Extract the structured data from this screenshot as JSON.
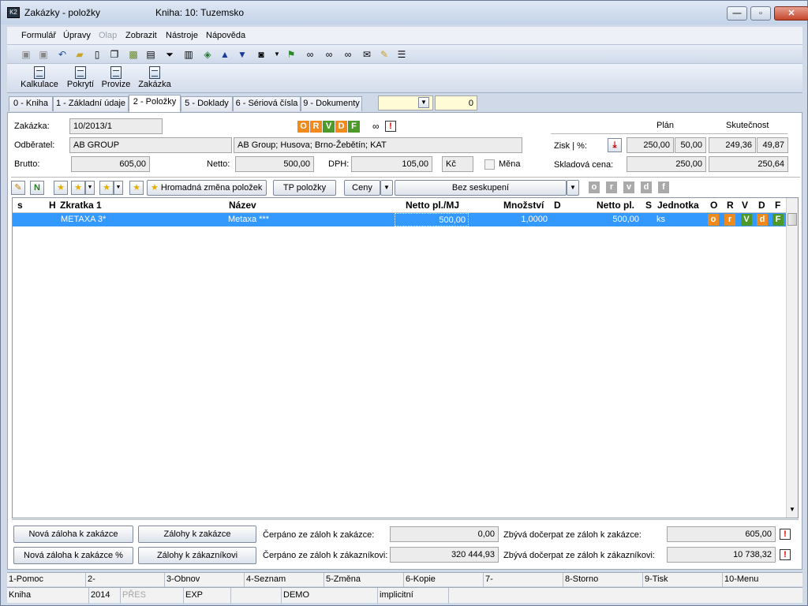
{
  "window": {
    "title": "Zakázky - položky",
    "subtitle": "Kniha: 10: Tuzemsko",
    "minimize": "—",
    "maximize": "▫",
    "close": "✕"
  },
  "menu": [
    {
      "label": "Formulář",
      "disabled": false
    },
    {
      "label": "Úpravy",
      "disabled": false
    },
    {
      "label": "Olap",
      "disabled": true
    },
    {
      "label": "Zobrazit",
      "disabled": false
    },
    {
      "label": "Nástroje",
      "disabled": false
    },
    {
      "label": "Nápověda",
      "disabled": false
    }
  ],
  "toolbar2": [
    {
      "label": "Kalkulace"
    },
    {
      "label": "Pokrytí"
    },
    {
      "label": "Provize"
    },
    {
      "label": "Zakázka"
    }
  ],
  "tabs": [
    {
      "label": "0 - Kniha"
    },
    {
      "label": "1 - Základní údaje"
    },
    {
      "label": "2 - Položky"
    },
    {
      "label": "5 - Doklady"
    },
    {
      "label": "6 - Sériová čísla"
    },
    {
      "label": "9 - Dokumenty"
    }
  ],
  "tab_extra_value": "0",
  "form": {
    "zakazka_label": "Zakázka:",
    "zakazka_value": "10/2013/1",
    "odberatel_label": "Odběratel:",
    "odberatel_value": "AB GROUP",
    "odberatel_address": "AB Group; Husova; Brno-Žebětín; KAT",
    "brutto_label": "Brutto:",
    "brutto_value": "605,00",
    "netto_label": "Netto:",
    "netto_value": "500,00",
    "dph_label": "DPH:",
    "dph_value": "105,00",
    "currency_value": "Kč",
    "mena_label": "Měna",
    "status_letters": [
      "O",
      "R",
      "V",
      "D",
      "F"
    ],
    "plan_header": "Plán",
    "skutecnost_header": "Skutečnost",
    "zisk_label": "Zisk | %:",
    "zisk_plan": "250,00",
    "zisk_plan_pct": "50,00",
    "zisk_skut": "249,36",
    "zisk_skut_pct": "49,87",
    "sklad_label": "Skladová cena:",
    "sklad_plan": "250,00",
    "sklad_skut": "250,64"
  },
  "gridtoolbar": {
    "hromadna": "Hromadná změna položek",
    "tp": "TP položky",
    "ceny": "Ceny",
    "seskupeni": "Bez seskupení",
    "letters": [
      "o",
      "r",
      "v",
      "d",
      "f"
    ]
  },
  "grid": {
    "headers": {
      "s": "s",
      "h": "H",
      "zkratka": "Zkratka 1",
      "nazev": "Název",
      "netto_mj": "Netto pl./MJ",
      "mnozstvi": "Množství",
      "d": "D",
      "netto": "Netto pl.",
      "s2": "S",
      "jednotka": "Jednotka",
      "o": "O",
      "r": "R",
      "v": "V",
      "d2": "D",
      "f": "F"
    },
    "rows": [
      {
        "zkratka": "METAXA 3*",
        "nazev": "Metaxa ***",
        "netto_mj": "500,00",
        "mnozstvi": "1,0000",
        "netto": "500,00",
        "jednotka": "ks",
        "o": "o",
        "r": "r",
        "v": "V",
        "d": "d",
        "f": "F"
      }
    ]
  },
  "bottom": {
    "btn1": "Nová záloha k zakázce",
    "btn2": "Zálohy k zakázce",
    "btn3": "Nová záloha k zakázce %",
    "btn4": "Zálohy k zákazníkovi",
    "cerp_zak_label": "Čerpáno ze záloh k zakázce:",
    "cerp_zak_value": "0,00",
    "cerp_zaka_label": "Čerpáno ze záloh k zákazníkovi:",
    "cerp_zaka_value": "320 444,93",
    "zbyva_zak_label": "Zbývá dočerpat ze záloh k zakázce:",
    "zbyva_zak_value": "605,00",
    "zbyva_zaka_label": "Zbývá dočerpat ze záloh k zákazníkovi:",
    "zbyva_zaka_value": "10 738,32"
  },
  "fkeys": [
    "1-Pomoc",
    "2-",
    "3-Obnov",
    "4-Seznam",
    "5-Změna",
    "6-Kopie",
    "7-",
    "8-Storno",
    "9-Tisk",
    "10-Menu"
  ],
  "status": [
    {
      "label": "Kniha",
      "disabled": false
    },
    {
      "label": "2014",
      "disabled": false
    },
    {
      "label": "PŘES",
      "disabled": true
    },
    {
      "label": "EXP",
      "disabled": false
    },
    {
      "label": "",
      "disabled": false
    },
    {
      "label": "DEMO",
      "disabled": false
    },
    {
      "label": "implicitní",
      "disabled": false
    },
    {
      "label": "",
      "disabled": false
    }
  ],
  "colors": {
    "selection": "#3399ff",
    "o": "#f08a1c",
    "r": "#f08a1c",
    "v": "#4d9a2a",
    "d": "#f08a1c",
    "f": "#4d9a2a",
    "window_bg": "#cfd9e8"
  }
}
